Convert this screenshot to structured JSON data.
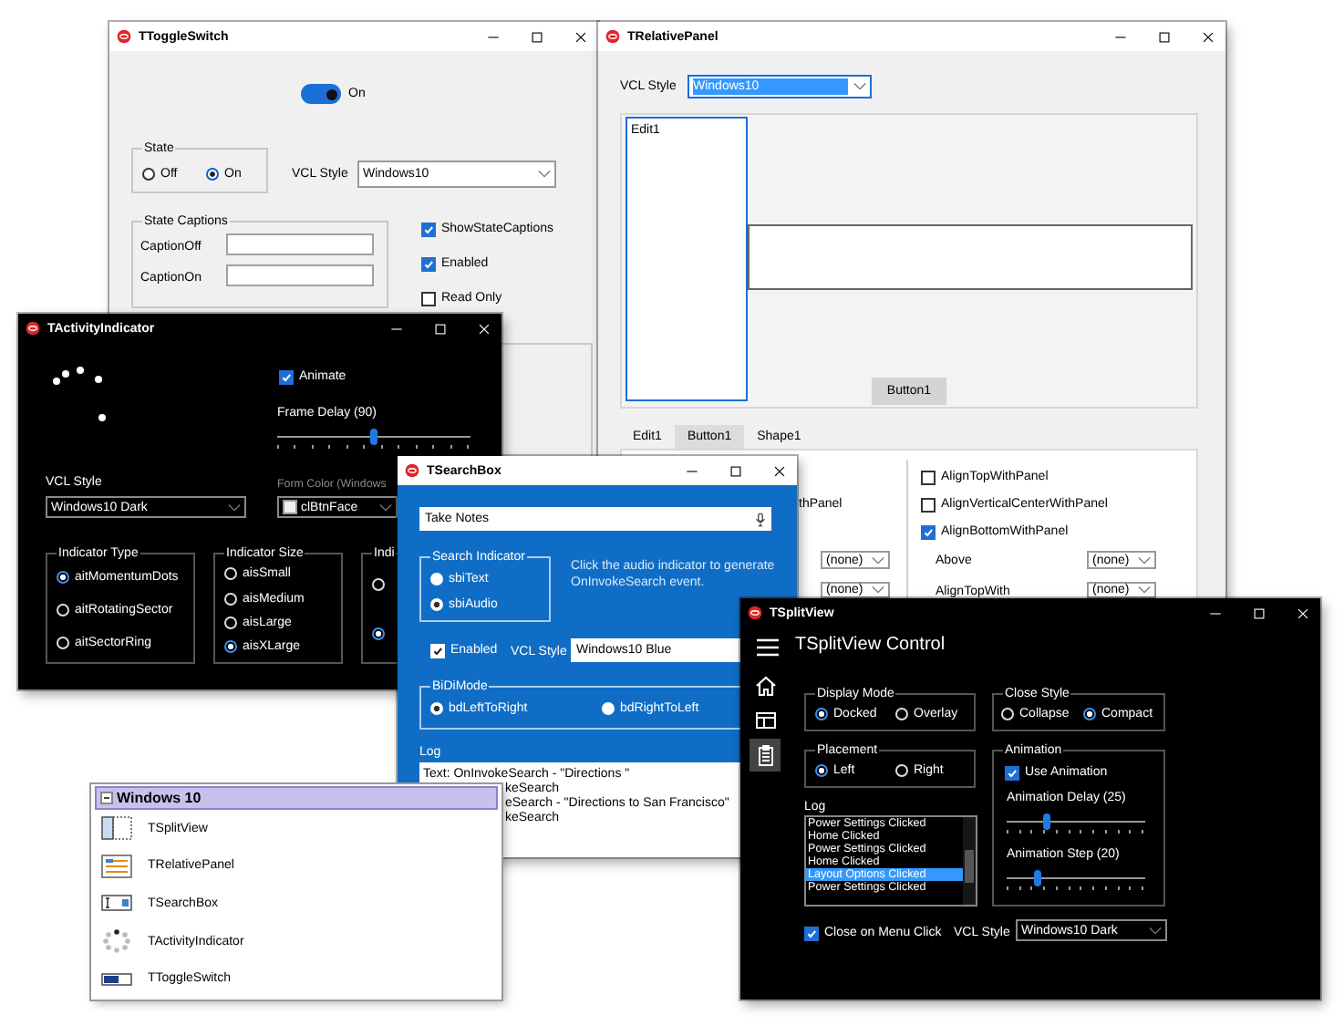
{
  "toggle_switch_window": {
    "title": "TToggleSwitch",
    "toggle": {
      "on": true,
      "label": "On"
    },
    "state_group": {
      "title": "State",
      "options": [
        {
          "label": "Off",
          "selected": false
        },
        {
          "label": "On",
          "selected": true
        }
      ]
    },
    "vcl_style": {
      "label": "VCL Style",
      "value": "Windows10"
    },
    "captions_group": {
      "title": "State Captions",
      "fields": [
        {
          "label": "CaptionOff"
        },
        {
          "label": "CaptionOn"
        }
      ]
    },
    "checkboxes": [
      {
        "label": "ShowStateCaptions",
        "checked": true
      },
      {
        "label": "Enabled",
        "checked": true
      },
      {
        "label": "Read Only",
        "checked": false
      }
    ]
  },
  "relative_panel_window": {
    "title": "TRelativePanel",
    "vcl_style": {
      "label": "VCL Style",
      "value": "Windows10"
    },
    "memo": "Edit1",
    "button": "Button1",
    "tabs": [
      {
        "label": "Edit1",
        "selected": false
      },
      {
        "label": "Button1",
        "selected": true
      },
      {
        "label": "Shape1",
        "selected": false
      }
    ],
    "left_fragment": "thPanel",
    "left_combos": [
      "(none)",
      "(none)"
    ],
    "align_checks": [
      {
        "label": "AlignTopWithPanel",
        "checked": false
      },
      {
        "label": "AlignVerticalCenterWithPanel",
        "checked": false
      },
      {
        "label": "AlignBottomWithPanel",
        "checked": true
      }
    ],
    "relations": [
      {
        "label": "Above",
        "value": "(none)"
      },
      {
        "label": "AlignTopWith",
        "value": "(none)"
      }
    ]
  },
  "activity_indicator_window": {
    "title": "TActivityIndicator",
    "animate": {
      "label": "Animate",
      "checked": true
    },
    "frame_delay": {
      "label": "Frame Delay (90)",
      "level": 0.5
    },
    "vcl_style": {
      "label": "VCL Style",
      "value": "Windows10 Dark"
    },
    "form_color": {
      "label": "Form Color (Windows",
      "value": "clBtnFace"
    },
    "groups": [
      {
        "title": "Indicator Type",
        "options": [
          {
            "label": "aitMomentumDots",
            "selected": true
          },
          {
            "label": "aitRotatingSector",
            "selected": false
          },
          {
            "label": "aitSectorRing",
            "selected": false
          }
        ]
      },
      {
        "title": "Indicator Size",
        "options": [
          {
            "label": "aisSmall",
            "selected": false
          },
          {
            "label": "aisMedium",
            "selected": false
          },
          {
            "label": "aisLarge",
            "selected": false
          },
          {
            "label": "aisXLarge",
            "selected": true
          }
        ]
      },
      {
        "title": "Indi",
        "options": [
          {
            "selected": false
          },
          {
            "selected": true
          }
        ]
      }
    ]
  },
  "search_box_window": {
    "title": "TSearchBox",
    "search": {
      "value": "Take Notes"
    },
    "indicator_group": {
      "title": "Search Indicator",
      "options": [
        {
          "label": "sbiText",
          "selected": false
        },
        {
          "label": "sbiAudio",
          "selected": true
        }
      ]
    },
    "hint": "Click the audio indicator to generate OnInvokeSearch event.",
    "enabled": {
      "label": "Enabled",
      "checked": true
    },
    "vcl_style": {
      "label": "VCL Style",
      "value": "Windows10 Blue"
    },
    "bidi_group": {
      "title": "BiDiMode",
      "options": [
        {
          "label": "bdLeftToRight",
          "selected": true
        },
        {
          "label": "bdRightToLeft",
          "selected": false
        }
      ]
    },
    "log": {
      "label": "Log",
      "lines": [
        "Text: OnInvokeSearch - \"Directions \"",
        "keSearch",
        "eSearch - \"Directions to San Francisco\"",
        "keSearch"
      ]
    }
  },
  "split_view_window": {
    "title": "TSplitView",
    "heading": "TSplitView Control",
    "nav": [
      {
        "kind": "home",
        "selected": false
      },
      {
        "kind": "layout",
        "selected": false
      },
      {
        "kind": "clipboard",
        "selected": true
      }
    ],
    "display_mode": {
      "title": "Display Mode",
      "options": [
        {
          "label": "Docked",
          "selected": true
        },
        {
          "label": "Overlay",
          "selected": false
        }
      ]
    },
    "close_style": {
      "title": "Close Style",
      "options": [
        {
          "label": "Collapse",
          "selected": false
        },
        {
          "label": "Compact",
          "selected": true
        }
      ]
    },
    "placement": {
      "title": "Placement",
      "options": [
        {
          "label": "Left",
          "selected": true
        },
        {
          "label": "Right",
          "selected": false
        }
      ]
    },
    "animation": {
      "title": "Animation",
      "use": {
        "label": "Use Animation",
        "checked": true
      },
      "sliders": [
        {
          "label": "Animation Delay (25)",
          "level": 0.29
        },
        {
          "label": "Animation Step (20)",
          "level": 0.23
        }
      ]
    },
    "log": {
      "label": "Log",
      "items": [
        {
          "text": "Power Settings Clicked",
          "selected": false
        },
        {
          "text": "Home Clicked",
          "selected": false
        },
        {
          "text": "Power Settings Clicked",
          "selected": false
        },
        {
          "text": "Home Clicked",
          "selected": false
        },
        {
          "text": "Layout Options Clicked",
          "selected": true
        },
        {
          "text": "Power Settings Clicked",
          "selected": false
        }
      ]
    },
    "close_on_click": {
      "label": "Close on Menu Click",
      "checked": true
    },
    "vcl_style": {
      "label": "VCL Style",
      "value": "Windows10 Dark"
    }
  },
  "component_palette": {
    "category": "Windows 10",
    "expanded": true,
    "items": [
      {
        "kind": "splitview",
        "label": "TSplitView"
      },
      {
        "kind": "relativepanel",
        "label": "TRelativePanel"
      },
      {
        "kind": "searchbox",
        "label": "TSearchBox"
      },
      {
        "kind": "activity",
        "label": "TActivityIndicator"
      },
      {
        "kind": "toggle",
        "label": "TToggleSwitch"
      }
    ]
  }
}
